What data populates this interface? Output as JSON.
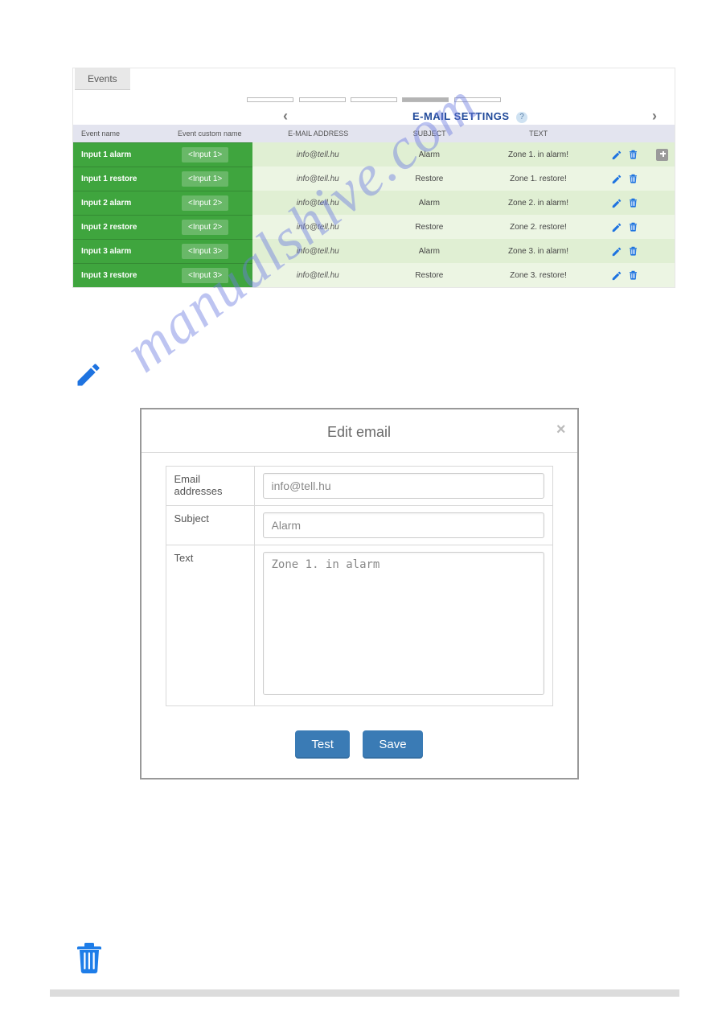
{
  "tab": {
    "label": "Events"
  },
  "header": {
    "title": "E-MAIL SETTINGS",
    "help_label": "?",
    "arrow_left": "‹",
    "arrow_right": "›",
    "col_eventname": "Event name",
    "col_custom": "Event custom name",
    "col_email": "E-MAIL ADDRESS",
    "col_subject": "SUBJECT",
    "col_text": "TEXT"
  },
  "rows": [
    {
      "name": "Input 1 alarm",
      "custom": "<Input 1>",
      "email": "info@tell.hu",
      "subject": "Alarm",
      "text": "Zone 1. in alarm!",
      "has_add": true
    },
    {
      "name": "Input 1 restore",
      "custom": "<Input 1>",
      "email": "info@tell.hu",
      "subject": "Restore",
      "text": "Zone 1. restore!",
      "has_add": false
    },
    {
      "name": "Input 2 alarm",
      "custom": "<Input 2>",
      "email": "info@tell.hu",
      "subject": "Alarm",
      "text": "Zone 2. in alarm!",
      "has_add": false
    },
    {
      "name": "Input 2 restore",
      "custom": "<Input 2>",
      "email": "info@tell.hu",
      "subject": "Restore",
      "text": "Zone 2. restore!",
      "has_add": false
    },
    {
      "name": "Input 3 alarm",
      "custom": "<Input 3>",
      "email": "info@tell.hu",
      "subject": "Alarm",
      "text": "Zone 3. in alarm!",
      "has_add": false
    },
    {
      "name": "Input 3 restore",
      "custom": "<Input 3>",
      "email": "info@tell.hu",
      "subject": "Restore",
      "text": "Zone 3. restore!",
      "has_add": false
    }
  ],
  "modal": {
    "title": "Edit email",
    "lbl_email": "Email addresses",
    "lbl_subject": "Subject",
    "lbl_text": "Text",
    "val_email": "info@tell.hu",
    "val_subject": "Alarm",
    "val_text": "Zone 1. in alarm",
    "btn_test": "Test",
    "btn_save": "Save",
    "close": "×"
  },
  "watermark": "manualshive.com"
}
